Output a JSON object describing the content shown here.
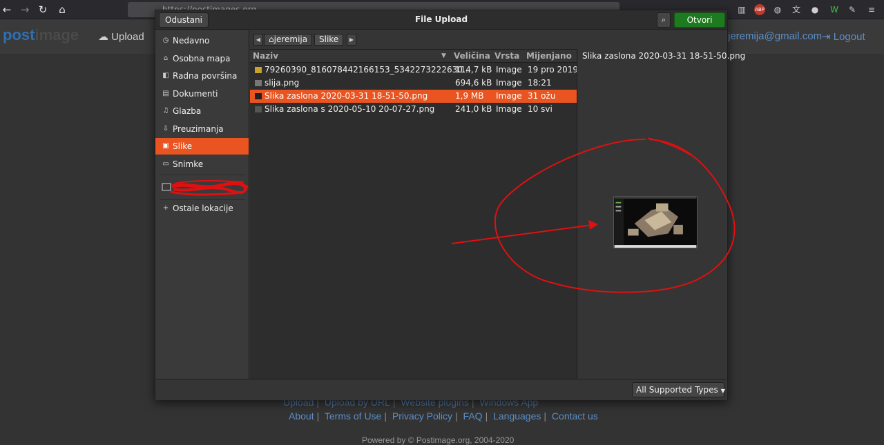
{
  "browser": {
    "url": "https://postimages.org"
  },
  "site": {
    "logo_part1": "post",
    "logo_part2": "image",
    "upload_label": "Upload",
    "email": "jeremija@gmail.com",
    "logout_label": "Logout",
    "footer_row1": [
      "Upload",
      "Upload by URL",
      "Website plugins",
      "Windows App"
    ],
    "footer_row2": [
      "About",
      "Terms of Use",
      "Privacy Policy",
      "FAQ",
      "Languages",
      "Contact us"
    ],
    "powered": "Powered by © Postimage.org, 2004-2020"
  },
  "dialog": {
    "title": "File Upload",
    "cancel_label": "Odustani",
    "open_label": "Otvori",
    "sidebar": [
      {
        "label": "Nedavno",
        "icon": "clock-icon",
        "selected": false
      },
      {
        "label": "Osobna mapa",
        "icon": "home-icon",
        "selected": false
      },
      {
        "label": "Radna površina",
        "icon": "desktop-icon",
        "selected": false
      },
      {
        "label": "Dokumenti",
        "icon": "document-icon",
        "selected": false
      },
      {
        "label": "Glazba",
        "icon": "music-icon",
        "selected": false
      },
      {
        "label": "Preuzimanja",
        "icon": "download-icon",
        "selected": false
      },
      {
        "label": "Slike",
        "icon": "image-icon",
        "selected": true
      },
      {
        "label": "Snimke",
        "icon": "video-icon",
        "selected": false
      }
    ],
    "other_locations": "Ostale lokacije",
    "path": [
      "jeremija",
      "Slike"
    ],
    "columns": {
      "name": "Naziv",
      "size": "Veličina",
      "type": "Vrsta",
      "modified": "Mijenjano"
    },
    "files": [
      {
        "name": "79260390_816078442166153_5342273222630…",
        "size": "114,7 kB",
        "type": "Image",
        "modified": "19 pro 2019",
        "selected": false
      },
      {
        "name": "slija.png",
        "size": "694,6 kB",
        "type": "Image",
        "modified": "18:21",
        "selected": false
      },
      {
        "name": "Slika zaslona 2020-03-31 18-51-50.png",
        "size": "1,9 MB",
        "type": "Image",
        "modified": "31 ožu",
        "selected": true
      },
      {
        "name": "Slika zaslona s 2020-05-10 20-07-27.png",
        "size": "241,0 kB",
        "type": "Image",
        "modified": "10 svi",
        "selected": false
      }
    ],
    "preview_name": "Slika zaslona 2020-03-31 18-51-50.png",
    "filter_label": "All Supported Types"
  },
  "colors": {
    "accent": "#e95420",
    "open_button": "#1e7a1e",
    "annotation": "#e01010"
  }
}
